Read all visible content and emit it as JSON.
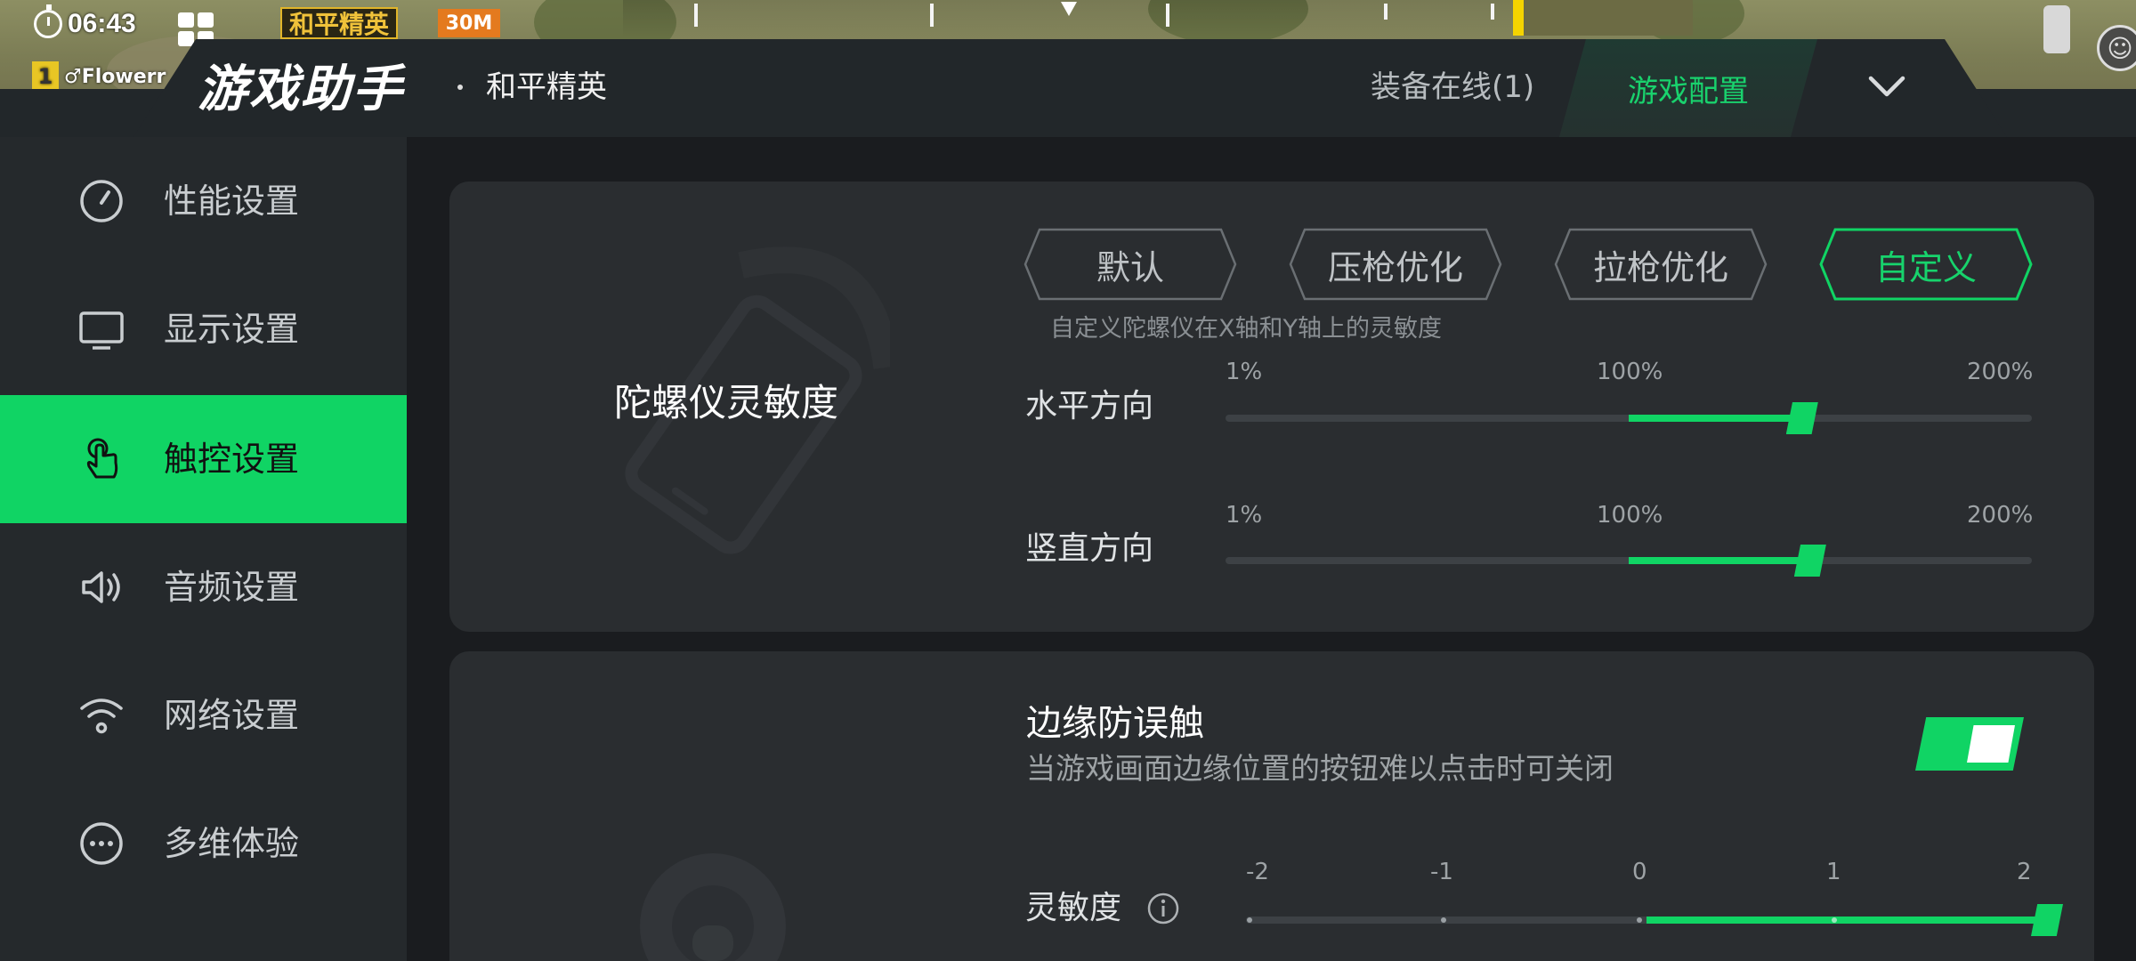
{
  "status": {
    "time": "06:43",
    "game_badge": "和平精英",
    "orange_badge": "30M",
    "player_number": "1",
    "player_name": "♂Flowerr"
  },
  "header": {
    "app_title": "游戏助手",
    "separator": "·",
    "game_name": "和平精英",
    "tabs": [
      {
        "label": "装备在线(1)",
        "active": false
      },
      {
        "label": "游戏配置",
        "active": true
      }
    ],
    "collapse_icon": "chevron-down-icon"
  },
  "sidebar": {
    "items": [
      {
        "label": "性能设置",
        "icon": "speedometer-icon",
        "active": false
      },
      {
        "label": "显示设置",
        "icon": "monitor-icon",
        "active": false
      },
      {
        "label": "触控设置",
        "icon": "touch-hand-icon",
        "active": true
      },
      {
        "label": "音频设置",
        "icon": "speaker-icon",
        "active": false
      },
      {
        "label": "网络设置",
        "icon": "wifi-icon",
        "active": false
      },
      {
        "label": "多维体验",
        "icon": "more-dots-icon",
        "active": false
      }
    ]
  },
  "gyro": {
    "title": "陀螺仪灵敏度",
    "modes": [
      {
        "label": "默认",
        "active": false
      },
      {
        "label": "压枪优化",
        "active": false
      },
      {
        "label": "拉枪优化",
        "active": false
      },
      {
        "label": "自定义",
        "active": true
      }
    ],
    "hint": "自定义陀螺仪在X轴和Y轴上的灵敏度",
    "sliders": [
      {
        "label": "水平方向",
        "min_label": "1%",
        "mid_label": "100%",
        "max_label": "200%",
        "value_percent": 143
      },
      {
        "label": "竖直方向",
        "min_label": "1%",
        "mid_label": "100%",
        "max_label": "200%",
        "value_percent": 145
      }
    ]
  },
  "edge": {
    "title": "边缘防误触",
    "description": "当游戏画面边缘位置的按钮难以点击时可关闭",
    "toggle_on": true,
    "sensitivity": {
      "label": "灵敏度",
      "ticks": [
        "-2",
        "-1",
        "0",
        "1",
        "2"
      ],
      "value": 2
    }
  },
  "colors": {
    "accent": "#10d464",
    "accent_text": "#17d36c",
    "panel": "#2a2d30",
    "sidebar": "#25292c",
    "background": "#1a1c1f"
  }
}
